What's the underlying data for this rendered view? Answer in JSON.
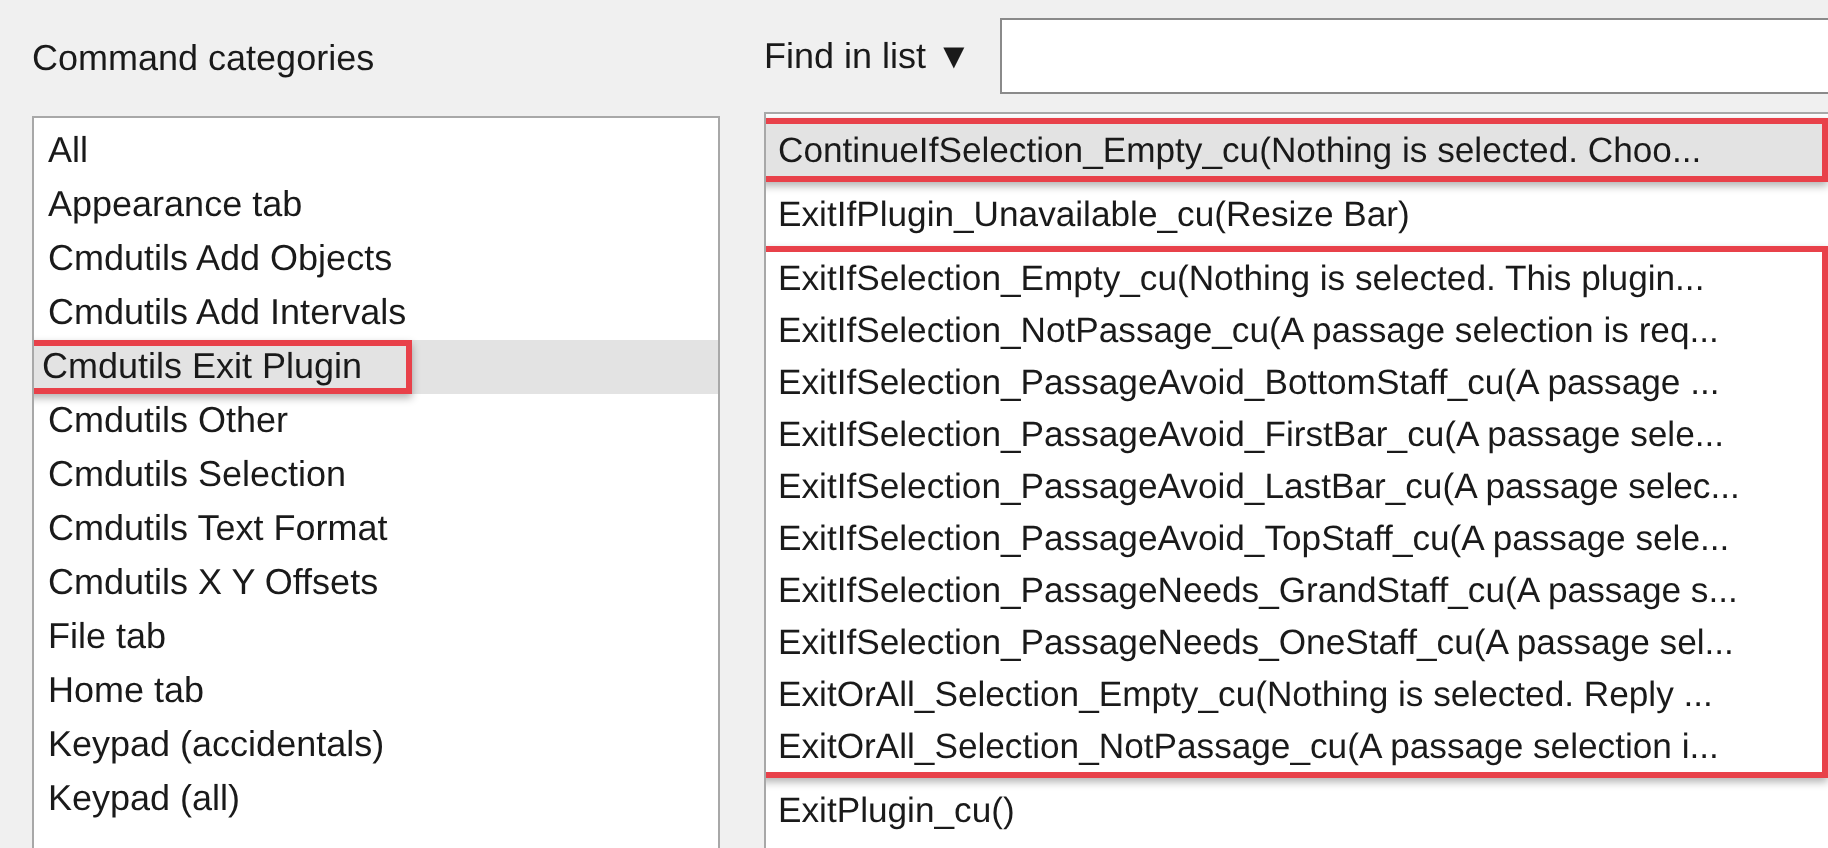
{
  "categories": {
    "heading": "Command categories",
    "items": [
      {
        "label": "All",
        "selected": false,
        "marked": false
      },
      {
        "label": "Appearance tab",
        "selected": false,
        "marked": false
      },
      {
        "label": "Cmdutils Add Objects",
        "selected": false,
        "marked": false
      },
      {
        "label": "Cmdutils Add Intervals",
        "selected": false,
        "marked": false
      },
      {
        "label": "Cmdutils Exit Plugin",
        "selected": true,
        "marked": true
      },
      {
        "label": "Cmdutils Other",
        "selected": false,
        "marked": false
      },
      {
        "label": "Cmdutils Selection",
        "selected": false,
        "marked": false
      },
      {
        "label": "Cmdutils Text Format",
        "selected": false,
        "marked": false
      },
      {
        "label": "Cmdutils X Y Offsets",
        "selected": false,
        "marked": false
      },
      {
        "label": "File tab",
        "selected": false,
        "marked": false
      },
      {
        "label": "Home tab",
        "selected": false,
        "marked": false
      },
      {
        "label": "Keypad (accidentals)",
        "selected": false,
        "marked": false
      },
      {
        "label": "Keypad (all)",
        "selected": false,
        "marked": false
      }
    ]
  },
  "commands": {
    "find_label": "Find in list ▼",
    "groups": [
      {
        "highlighted": true,
        "items": [
          {
            "label": "ContinueIfSelection_Empty_cu(Nothing is selected. Choo...",
            "selected": true
          }
        ]
      },
      {
        "highlighted": false,
        "items": [
          {
            "label": "ExitIfPlugin_Unavailable_cu(Resize Bar)",
            "selected": false
          }
        ]
      },
      {
        "highlighted": true,
        "items": [
          {
            "label": "ExitIfSelection_Empty_cu(Nothing is selected. This plugin...",
            "selected": false
          },
          {
            "label": "ExitIfSelection_NotPassage_cu(A passage selection is req...",
            "selected": false
          },
          {
            "label": "ExitIfSelection_PassageAvoid_BottomStaff_cu(A passage ...",
            "selected": false
          },
          {
            "label": "ExitIfSelection_PassageAvoid_FirstBar_cu(A passage sele...",
            "selected": false
          },
          {
            "label": "ExitIfSelection_PassageAvoid_LastBar_cu(A passage selec...",
            "selected": false
          },
          {
            "label": "ExitIfSelection_PassageAvoid_TopStaff_cu(A passage sele...",
            "selected": false
          },
          {
            "label": "ExitIfSelection_PassageNeeds_GrandStaff_cu(A passage s...",
            "selected": false
          },
          {
            "label": "ExitIfSelection_PassageNeeds_OneStaff_cu(A passage sel...",
            "selected": false
          },
          {
            "label": "ExitOrAll_Selection_Empty_cu(Nothing is selected. Reply ...",
            "selected": false
          },
          {
            "label": "ExitOrAll_Selection_NotPassage_cu(A passage selection i...",
            "selected": false
          }
        ]
      },
      {
        "highlighted": false,
        "items": [
          {
            "label": "ExitPlugin_cu()",
            "selected": false
          }
        ]
      }
    ]
  }
}
